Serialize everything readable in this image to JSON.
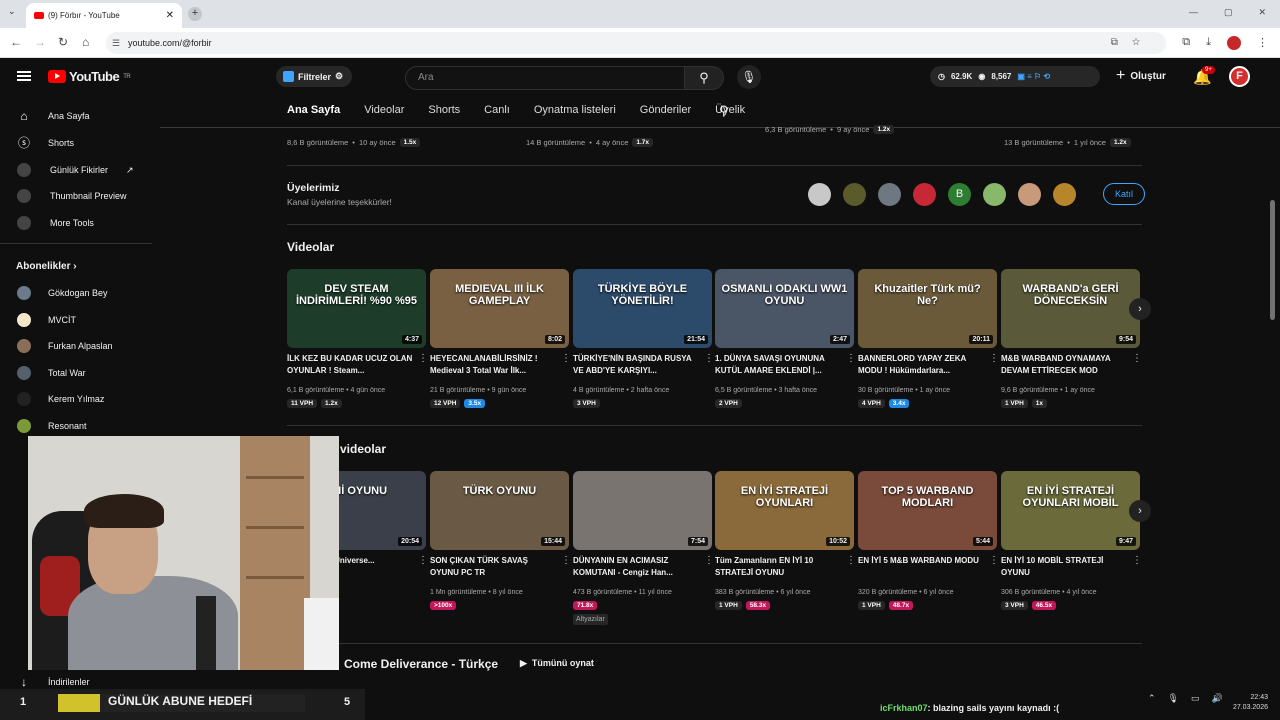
{
  "browser": {
    "tab_title": "(9) Förbır - YouTube",
    "url": "youtube.com/@forbir"
  },
  "header": {
    "logo": "YouTube",
    "logo_country": "TR",
    "filters_label": "Filtreler",
    "search_placeholder": "Ara",
    "stat_views": "62.9K",
    "stat_subs": "8,567",
    "create_label": "Oluştur",
    "notif_count": "9+",
    "avatar_letter": "F"
  },
  "sidebar": {
    "items": [
      {
        "label": "Ana Sayfa",
        "icon": "home-icon"
      },
      {
        "label": "Shorts",
        "icon": "shorts-icon"
      },
      {
        "label": "Günlük Fikirler",
        "icon": "idea-icon"
      },
      {
        "label": "Thumbnail Preview",
        "icon": "preview-icon"
      },
      {
        "label": "More Tools",
        "icon": "tools-icon"
      }
    ],
    "subs_heading": "Abonelikler",
    "subs": [
      {
        "label": "Gökdogan Bey",
        "color": "#6b7b8c"
      },
      {
        "label": "MVCİT",
        "color": "#f2e7c9"
      },
      {
        "label": "Furkan Alpaslan",
        "color": "#8a6e5a"
      },
      {
        "label": "Total War",
        "color": "#55606a"
      },
      {
        "label": "Kerem Yılmaz",
        "color": "#222"
      },
      {
        "label": "Resonant",
        "color": "#7a9a3a"
      }
    ],
    "partial_heading": "Siz",
    "downloads_label": "İndirilenler"
  },
  "channel_tabs": [
    "Ana Sayfa",
    "Videolar",
    "Shorts",
    "Canlı",
    "Oynatma listeleri",
    "Gönderiler",
    "Üyelik"
  ],
  "top_row_meta": [
    {
      "views": "8,6 B görüntüleme",
      "age": "10 ay önce",
      "mult": "1.5x"
    },
    {
      "views": "14 B görüntüleme",
      "age": "4 ay önce",
      "mult": "1.7x"
    },
    {
      "views": "6,3 B görüntüleme",
      "age": "9 ay önce",
      "mult": "1.2x"
    },
    {
      "views": "13 B görüntüleme",
      "age": "1 yıl önce",
      "mult": "1.2x"
    }
  ],
  "members": {
    "title": "Üyelerimiz",
    "subtitle": "Kanal üyelerine teşekkürler!",
    "join_label": "Katıl",
    "avatar_B": "B"
  },
  "videos_section": {
    "title": "Videolar",
    "items": [
      {
        "thumb": "DEV STEAM İNDİRİMLERİ! %90 %95",
        "dur": "4:37",
        "title": "İLK KEZ BU KADAR UCUZ OLAN OYUNLAR ! Steam...",
        "views": "6,1 B görüntüleme",
        "age": "4 gün önce",
        "vph": "11 VPH",
        "mult": "1.2x",
        "bg": "#1d3d2a",
        "mc": ""
      },
      {
        "thumb": "MEDIEVAL III İLK GAMEPLAY",
        "dur": "8:02",
        "title": "HEYECANLANABİLİRSİNİZ ! Medieval 3 Total War İlk...",
        "views": "21 B görüntüleme",
        "age": "9 gün önce",
        "vph": "12 VPH",
        "mult": "3.5x",
        "bg": "#7a6042",
        "mc": "blue"
      },
      {
        "thumb": "TÜRKİYE BÖYLE YÖNETİLİR!",
        "dur": "21:54",
        "title": "TÜRKİYE'NİN BAŞINDA RUSYA VE ABD'YE KARŞIYI...",
        "views": "4 B görüntüleme",
        "age": "2 hafta önce",
        "vph": "3 VPH",
        "mult": "",
        "bg": "#2c4a6a",
        "mc": ""
      },
      {
        "thumb": "OSMANLI ODAKLI WW1 OYUNU",
        "dur": "2:47",
        "title": "1. DÜNYA SAVAŞI OYUNUNA KUTÜL AMARE EKLENDİ |...",
        "views": "6,5 B görüntüleme",
        "age": "3 hafta önce",
        "vph": "2 VPH",
        "mult": "",
        "bg": "#4a5566",
        "mc": ""
      },
      {
        "thumb": "Khuzaitler Türk mü? Ne?",
        "dur": "20:11",
        "title": "BANNERLORD YAPAY ZEKA MODU ! Hükümdarlara...",
        "views": "30 B görüntüleme",
        "age": "1 ay önce",
        "vph": "4 VPH",
        "mult": "3.4x",
        "bg": "#6a5a3a",
        "mc": "blue"
      },
      {
        "thumb": "WARBAND'a GERİ DÖNECEKSİN",
        "dur": "9:54",
        "title": "M&B WARBAND OYNAMAYA DEVAM ETTİRECEK MOD",
        "views": "9,6 B görüntüleme",
        "age": "1 ay önce",
        "vph": "1 VPH",
        "mult": "1x",
        "bg": "#5a5a3a",
        "mc": ""
      }
    ]
  },
  "popular_section": {
    "title_partial": "videolar",
    "items": [
      {
        "thumb": "ENİ OYUNU",
        "dur": "20:54",
        "title": "OYUNU | he Universe...",
        "views": "",
        "age": "8 yıl önce",
        "vph": "",
        "mult": "",
        "bg": "#3a3f4a",
        "mc": ""
      },
      {
        "thumb": "TÜRK OYUNU",
        "dur": "15:44",
        "title": "SON ÇIKAN TÜRK SAVAŞ OYUNU PC TR",
        "views": "1 Mn görüntüleme",
        "age": "8 yıl önce",
        "vph": "",
        "mult": ">100x",
        "bg": "#6a5a45",
        "mc": "red"
      },
      {
        "thumb": "",
        "dur": "7:54",
        "title": "DÜNYANIN EN ACIMASIZ KOMUTANI - Cengiz Han...",
        "views": "473 B görüntüleme",
        "age": "11 yıl önce",
        "vph": "",
        "mult": "71.8x",
        "bg": "#7a7470",
        "mc": "red"
      },
      {
        "thumb": "EN İYİ STRATEJİ OYUNLARI",
        "dur": "10:52",
        "title": "Tüm Zamanların EN İYİ 10 STRATEJİ OYUNU",
        "views": "383 B görüntüleme",
        "age": "6 yıl önce",
        "vph": "1 VPH",
        "mult": "58.3x",
        "bg": "#8a6a3a",
        "mc": "red"
      },
      {
        "thumb": "TOP 5 WARBAND MODLARI",
        "dur": "5:44",
        "title": "EN İYİ 5 M&B WARBAND MODU",
        "views": "320 B görüntüleme",
        "age": "6 yıl önce",
        "vph": "1 VPH",
        "mult": "48.7x",
        "bg": "#7a4a3a",
        "mc": "red"
      },
      {
        "thumb": "EN İYİ STRATEJİ OYUNLARI MOBİL",
        "dur": "9:47",
        "title": "EN İYİ 10 MOBİL STRATEJİ OYUNU",
        "views": "306 B görüntüleme",
        "age": "4 yıl önce",
        "vph": "3 VPH",
        "mult": "46.5x",
        "bg": "#6a6a3a",
        "mc": "red"
      }
    ],
    "subtitle_badge": "Altyazılar"
  },
  "playlist": {
    "title": "Come Deliverance - Türkçe",
    "play_all": "Tümünü oynat"
  },
  "overlay": {
    "goal_current": "1",
    "goal_label": "GÜNLÜK ABUNE HEDEFİ",
    "goal_target": "5",
    "chat_user": "icFrkhan07",
    "chat_msg": ": blazing sails yayını kaynadı :("
  },
  "clock": {
    "time": "22:43",
    "date": "27.03.2026"
  }
}
